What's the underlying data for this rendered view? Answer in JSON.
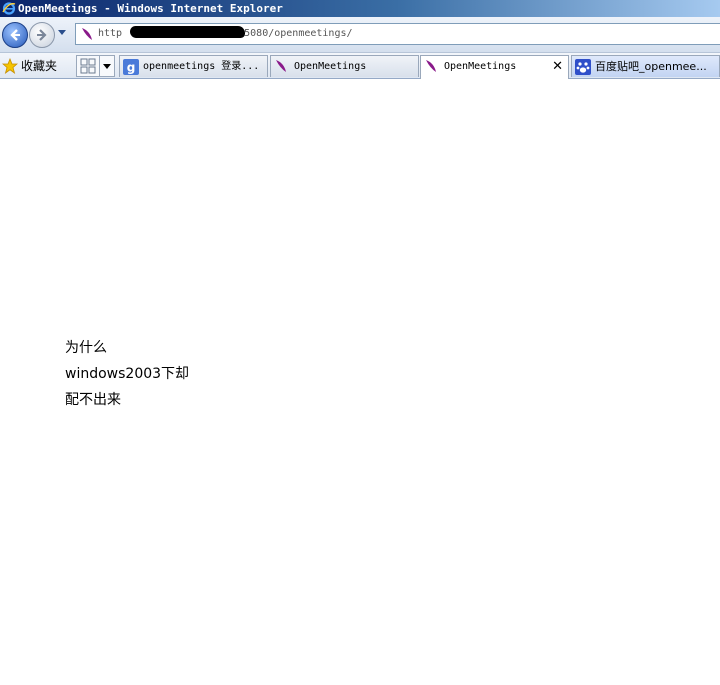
{
  "window": {
    "title": "OpenMeetings - Windows Internet Explorer"
  },
  "address_bar": {
    "url_prefix": "http",
    "url_suffix": ":5080/openmeetings/"
  },
  "favorites_bar": {
    "favorites_label": "收藏夹"
  },
  "tabs": [
    {
      "label": "openmeetings 登录...",
      "icon": "google-g-icon"
    },
    {
      "label": "OpenMeetings",
      "icon": "feather-icon"
    },
    {
      "label": "OpenMeetings",
      "icon": "feather-icon",
      "active": true,
      "close": "✕"
    },
    {
      "label": "百度贴吧_openmee...",
      "icon": "baidu-paw-icon"
    }
  ],
  "page_content": {
    "lines": [
      "为什么",
      "windows2003下却",
      "配不出来"
    ]
  },
  "colors": {
    "titlebar_start": "#0a246a",
    "titlebar_end": "#a6caf0",
    "feather": "#8a1a8a"
  }
}
